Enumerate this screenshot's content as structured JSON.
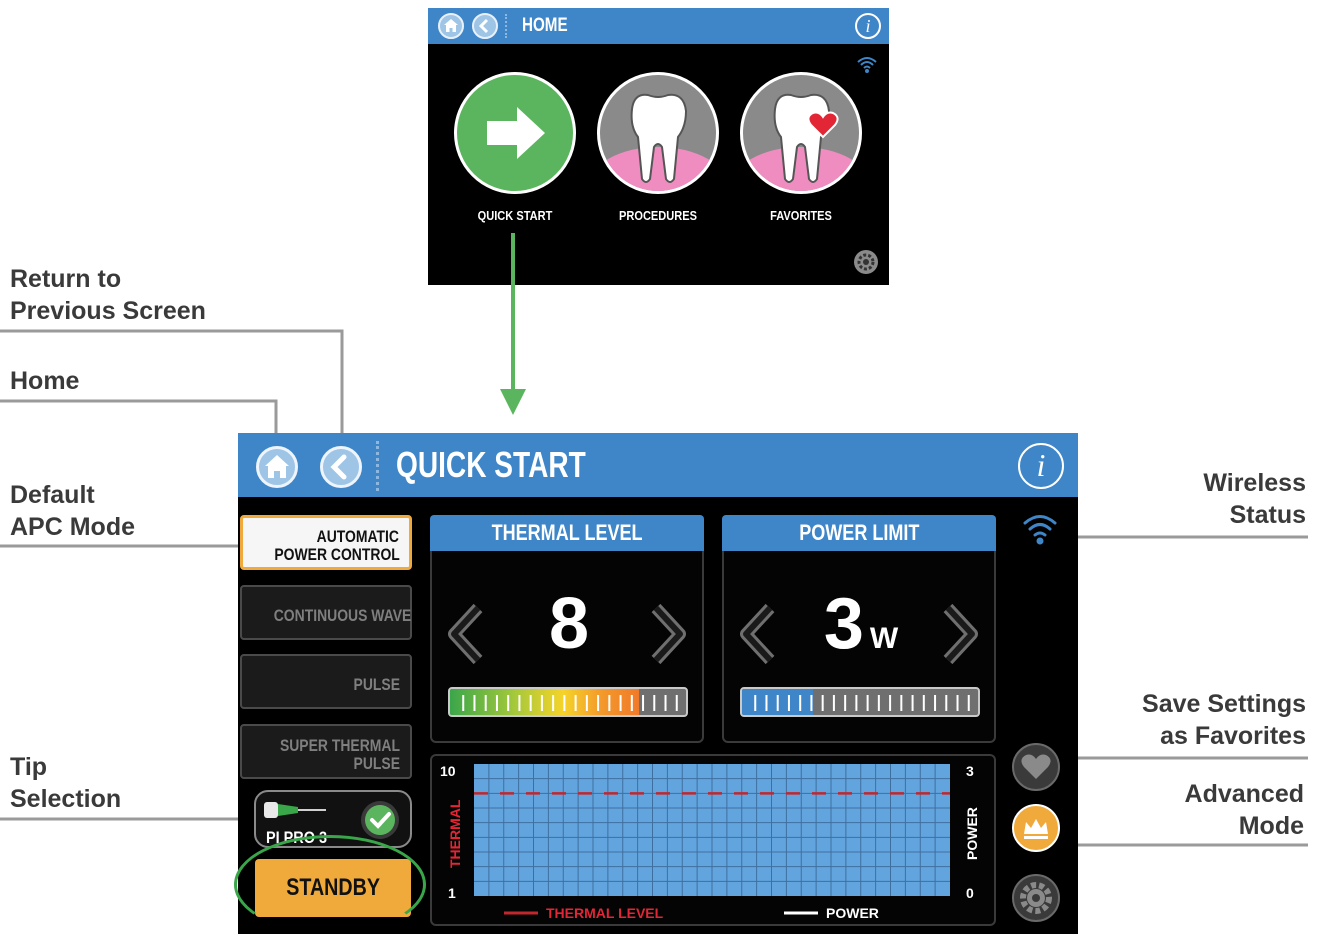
{
  "callouts": {
    "previous_screen": "Return to\nPrevious Screen",
    "home": "Home",
    "default_mode": "Default\nAPC Mode",
    "tip_selection": "Tip\nSelection",
    "wireless": "Wireless\nStatus",
    "favorites": "Save Settings\nas Favorites",
    "advanced": "Advanced\nMode"
  },
  "home_screen": {
    "title": "HOME",
    "info_label": "i",
    "tiles": [
      {
        "label": "QUICK START",
        "icon": "arrow-right-icon",
        "color": "#5bb55e"
      },
      {
        "label": "PROCEDURES",
        "icon": "tooth-icon",
        "color": "#ef8cc0"
      },
      {
        "label": "FAVORITES",
        "icon": "tooth-heart-icon",
        "color": "#ef8cc0"
      }
    ]
  },
  "screen": {
    "title": "QUICK START",
    "info_label": "i",
    "modes": [
      {
        "label_line1": "AUTOMATIC",
        "label_line2": "POWER CONTROL",
        "active": true
      },
      {
        "label_line1": "",
        "label_line2": "CONTINUOUS WAVE",
        "active": false
      },
      {
        "label_line1": "",
        "label_line2": "PULSE",
        "active": false
      },
      {
        "label_line1": "SUPER THERMAL",
        "label_line2": "PULSE",
        "active": false
      }
    ],
    "thermal": {
      "title": "THERMAL LEVEL",
      "value": "8",
      "level": 8,
      "max": 10
    },
    "power": {
      "title": "POWER LIMIT",
      "value": "3",
      "unit": "W",
      "level": 3,
      "max": 10
    },
    "tip": {
      "label": "PI PRO 3"
    },
    "standby_label": "STANDBY",
    "colors": {
      "accent": "#3f86c8",
      "standby": "#f0a93b",
      "thermal_line": "#c1272d",
      "advanced": "#f0a93b"
    }
  },
  "chart_data": {
    "type": "line",
    "title": "",
    "ylabel_left": "THERMAL",
    "ylabel_right": "POWER",
    "left_axis": {
      "min_label": "1",
      "max_label": "10"
    },
    "right_axis": {
      "min_label": "0",
      "max_label": "3"
    },
    "ylim_left": [
      1,
      10
    ],
    "ylim_right": [
      0,
      3
    ],
    "series": [
      {
        "name": "THERMAL LEVEL",
        "style": "dashed",
        "color": "#c1272d",
        "values": [
          8,
          8
        ]
      },
      {
        "name": "POWER",
        "style": "solid",
        "color": "#ffffff",
        "values": []
      }
    ],
    "grid": true
  }
}
